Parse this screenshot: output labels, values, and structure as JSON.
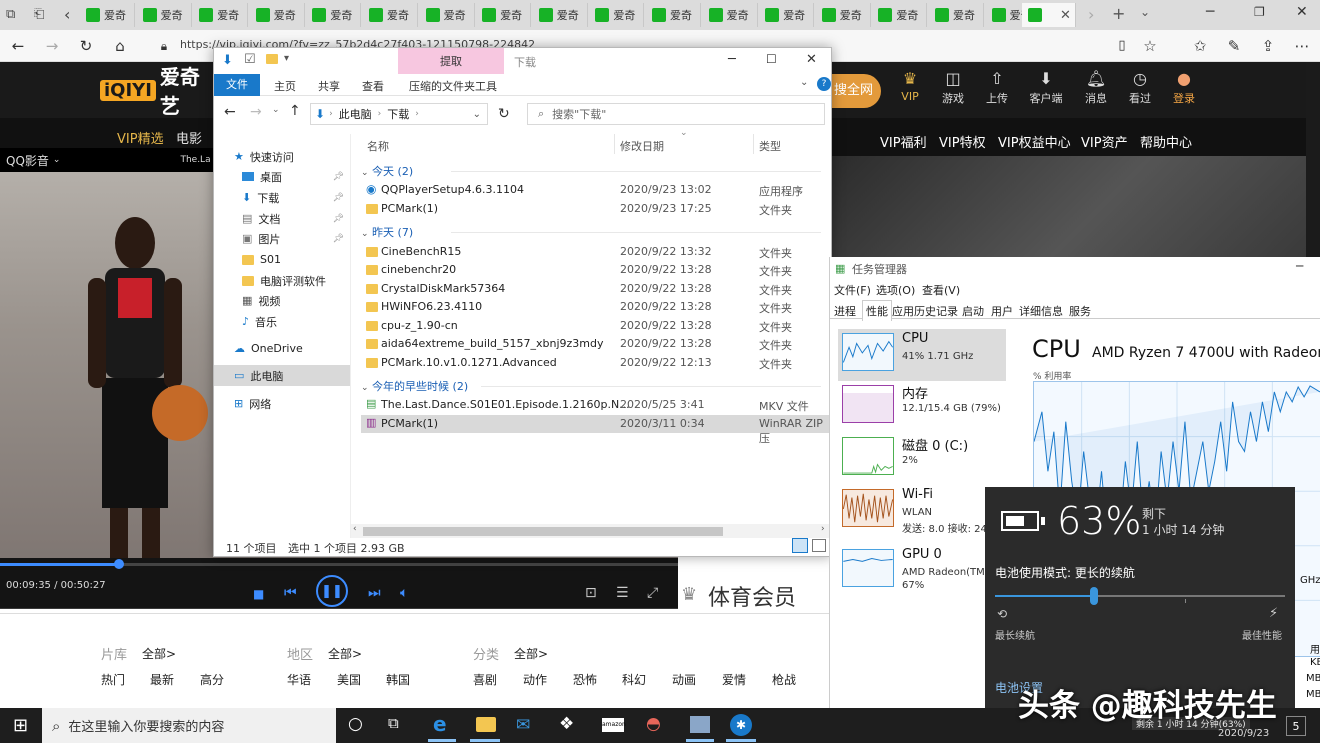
{
  "browser": {
    "tab_label": "爱奇",
    "url": "https://vip.iqiyi.com/?fv=zz_57b2d4c27f403-121150798-224842"
  },
  "iqiyi": {
    "logo_text": "爱奇艺",
    "logo_badge": "iQIYI",
    "search_button": "搜全网",
    "top_items": [
      "VIP",
      "游戏",
      "上传",
      "客户端",
      "消息",
      "看过",
      "登录"
    ],
    "nav2": [
      "VIP精选",
      "电影"
    ],
    "right_nav": [
      "VIP福利",
      "VIP特权",
      "VIP权益中心",
      "VIP资产",
      "帮助中心"
    ],
    "player": {
      "header_left": "QQ影音",
      "header_title": "The.La",
      "time": "00:09:35 / 00:50:27",
      "progress": 0.19
    },
    "sports_title": "体育会员",
    "filters": {
      "row1": [
        {
          "label": "片库",
          "value": "全部>"
        },
        {
          "label": "地区",
          "value": "全部>"
        },
        {
          "label": "分类",
          "value": "全部>"
        }
      ],
      "row2": [
        "热门",
        "最新",
        "高分",
        "华语",
        "美国",
        "韩国",
        "喜剧",
        "动作",
        "恐怖",
        "科幻",
        "动画",
        "爱情",
        "枪战"
      ]
    }
  },
  "explorer": {
    "extract_tab": "提取",
    "window_title": "下载",
    "ribbon_tabs": [
      "文件",
      "主页",
      "共享",
      "查看",
      "压缩的文件夹工具"
    ],
    "path": [
      "此电脑",
      "下载"
    ],
    "search_placeholder": "搜索\"下载\"",
    "nav": [
      "快速访问",
      "桌面",
      "下载",
      "文档",
      "图片",
      "S01",
      "电脑评测软件",
      "视频",
      "音乐",
      "OneDrive",
      "此电脑",
      "网络"
    ],
    "columns": [
      "名称",
      "修改日期",
      "类型"
    ],
    "groups": [
      {
        "title": "今天 (2)",
        "rows": [
          {
            "name": "QQPlayerSetup4.6.3.1104",
            "date": "2020/9/23 13:02",
            "type": "应用程序"
          },
          {
            "name": "PCMark(1)",
            "date": "2020/9/23 17:25",
            "type": "文件夹"
          }
        ]
      },
      {
        "title": "昨天 (7)",
        "rows": [
          {
            "name": "CineBenchR15",
            "date": "2020/9/22 13:32",
            "type": "文件夹"
          },
          {
            "name": "cinebenchr20",
            "date": "2020/9/22 13:28",
            "type": "文件夹"
          },
          {
            "name": "CrystalDiskMark57364",
            "date": "2020/9/22 13:28",
            "type": "文件夹"
          },
          {
            "name": "HWiNFO6.23.4110",
            "date": "2020/9/22 13:28",
            "type": "文件夹"
          },
          {
            "name": "cpu-z_1.90-cn",
            "date": "2020/9/22 13:28",
            "type": "文件夹"
          },
          {
            "name": "aida64extreme_build_5157_xbnj9z3mdy",
            "date": "2020/9/22 13:28",
            "type": "文件夹"
          },
          {
            "name": "PCMark.10.v1.0.1271.Advanced",
            "date": "2020/9/22 12:13",
            "type": "文件夹"
          }
        ]
      },
      {
        "title": "今年的早些时候 (2)",
        "rows": [
          {
            "name": "The.Last.Dance.S01E01.Episode.1.2160p.N...",
            "date": "2020/5/25 3:41",
            "type": "MKV 文件"
          },
          {
            "name": "PCMark(1)",
            "date": "2020/3/11 0:34",
            "type": "WinRAR ZIP 压"
          }
        ]
      }
    ],
    "status_count": "11 个项目",
    "status_selected": "选中 1 个项目  2.93 GB"
  },
  "taskmgr": {
    "title": "任务管理器",
    "menu": [
      "文件(F)",
      "选项(O)",
      "查看(V)"
    ],
    "tabs": [
      "进程",
      "性能",
      "应用历史记录",
      "启动",
      "用户",
      "详细信息",
      "服务"
    ],
    "side": [
      {
        "name": "CPU",
        "sub": "41% 1.71 GHz",
        "sub2": ""
      },
      {
        "name": "内存",
        "sub": "12.1/15.4 GB (79%)",
        "sub2": ""
      },
      {
        "name": "磁盘 0 (C:)",
        "sub": "2%",
        "sub2": ""
      },
      {
        "name": "Wi-Fi",
        "sub": "WLAN",
        "sub2": "发送: 8.0 接收: 24"
      },
      {
        "name": "GPU 0",
        "sub": "AMD Radeon(TM",
        "sub2": "67%"
      }
    ],
    "main_title": "CPU",
    "main_model": "AMD Ryzen 7 4700U with Radeon G",
    "util_label": "% 利用率",
    "right_fragments": [
      "GHz",
      "用",
      "KB",
      "MB",
      "MB"
    ]
  },
  "battery": {
    "percent": "63%",
    "remaining_label": "剩下",
    "remaining_time": "1 小时 14 分钟",
    "mode_label": "电池使用模式: 更长的续航",
    "slider_value": 0.34,
    "left_label": "最长续航",
    "right_label": "最佳性能",
    "settings_link": "电池设置"
  },
  "taskbar": {
    "search_placeholder": "在这里输入你要搜索的内容",
    "tray_tooltip": "剩余 1 小时 14 分钟(63%)",
    "date": "2020/9/23",
    "notif_count": "5"
  },
  "watermark": "头条 @趣科技先生"
}
